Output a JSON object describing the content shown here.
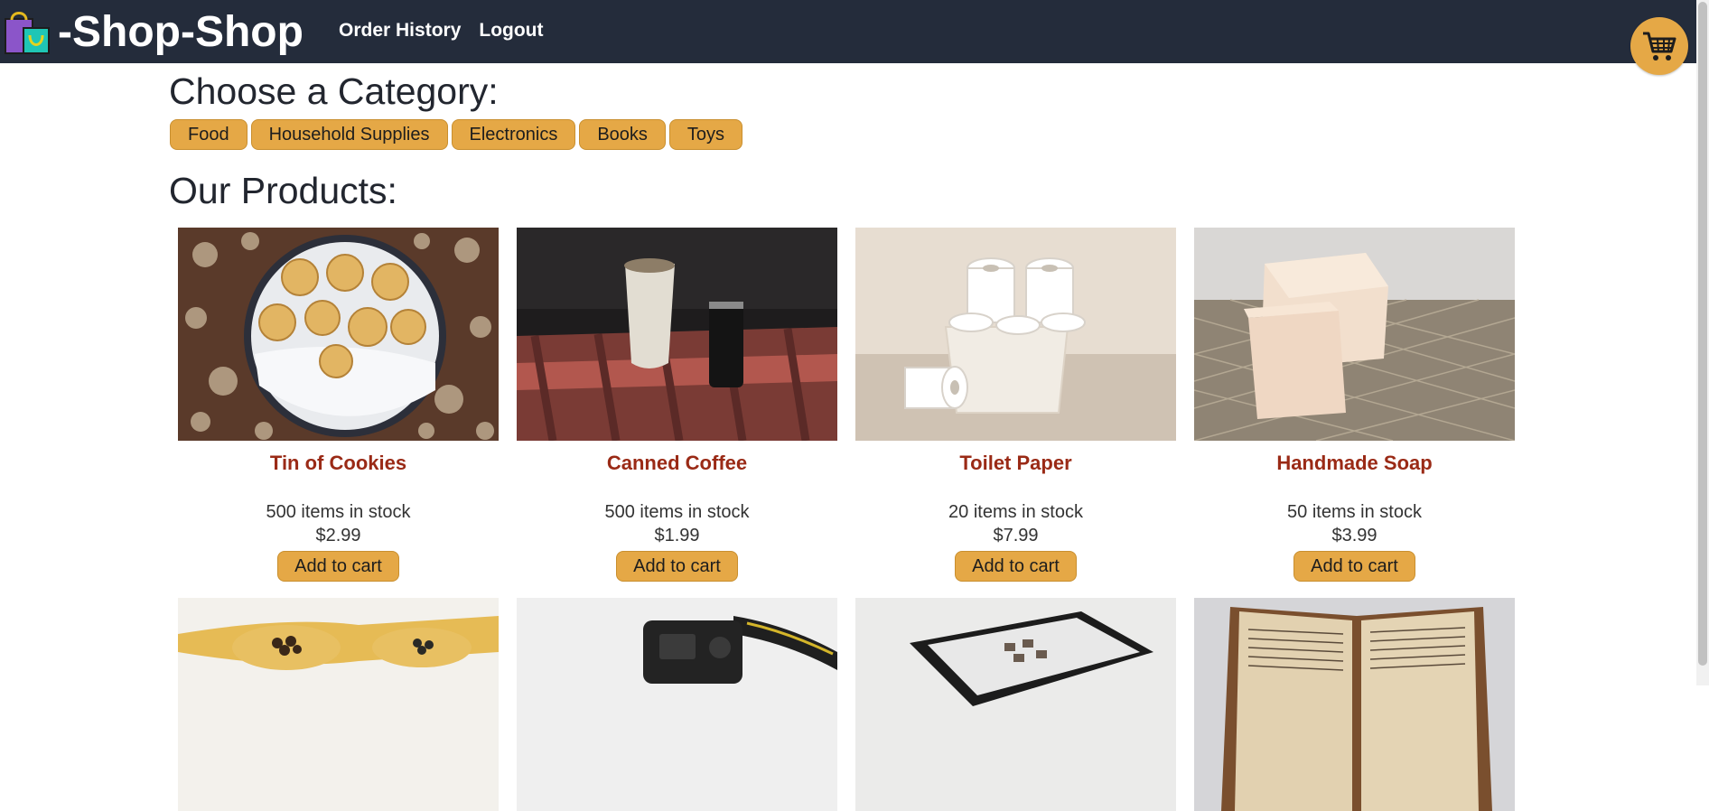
{
  "header": {
    "title": "-Shop-Shop",
    "links": [
      {
        "label": "Order History"
      },
      {
        "label": "Logout"
      }
    ],
    "cart_icon": "shopping-cart-icon"
  },
  "categories": {
    "heading": "Choose a Category:",
    "items": [
      "Food",
      "Household Supplies",
      "Electronics",
      "Books",
      "Toys"
    ]
  },
  "products": {
    "heading": "Our Products:",
    "items": [
      {
        "name": "Tin of Cookies",
        "stock": "500 items in stock",
        "price": "$2.99",
        "button": "Add to cart"
      },
      {
        "name": "Canned Coffee",
        "stock": "500 items in stock",
        "price": "$1.99",
        "button": "Add to cart"
      },
      {
        "name": "Toilet Paper",
        "stock": "20 items in stock",
        "price": "$7.99",
        "button": "Add to cart"
      },
      {
        "name": "Handmade Soap",
        "stock": "50 items in stock",
        "price": "$3.99",
        "button": "Add to cart"
      }
    ]
  },
  "colors": {
    "navbar": "#242c3b",
    "accent": "#e5a846",
    "product_name": "#9a2a16"
  }
}
